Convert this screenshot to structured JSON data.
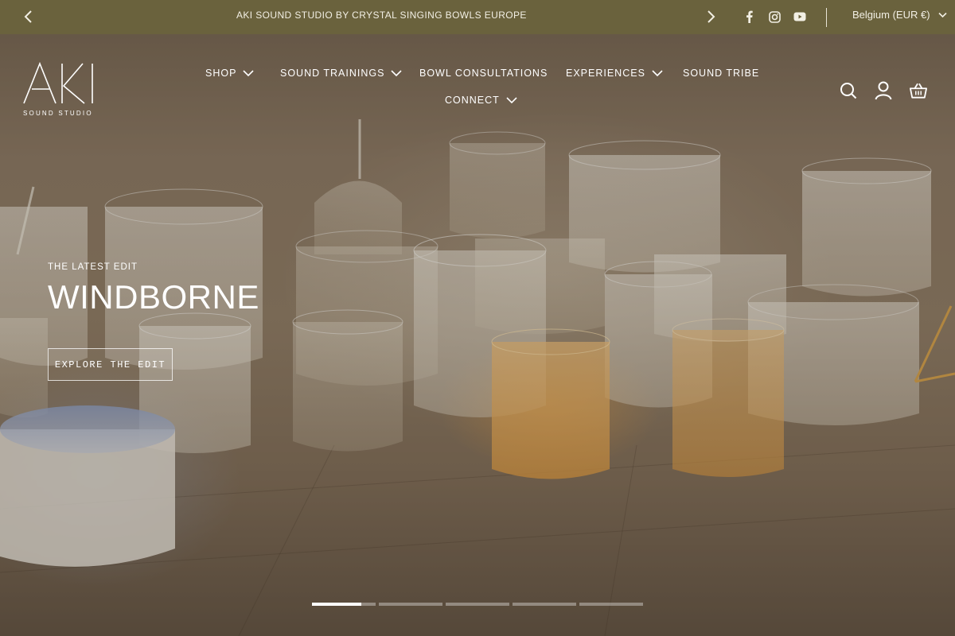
{
  "announcement": {
    "text": "AKI SOUND STUDIO BY CRYSTAL SINGING BOWLS EUROPE",
    "prev_icon": "chevron-left-icon",
    "next_icon": "chevron-right-icon"
  },
  "socials": [
    {
      "name": "facebook-icon"
    },
    {
      "name": "instagram-icon"
    },
    {
      "name": "youtube-icon"
    }
  ],
  "country_selector": {
    "label": "Belgium (EUR €)"
  },
  "brand": {
    "logo_text": "AKI",
    "sub": "SOUND STUDIO"
  },
  "nav": {
    "shop": "SHOP",
    "sound_trainings": "SOUND TRAININGS",
    "bowl_consultations": "BOWL CONSULTATIONS",
    "experiences": "EXPERIENCES",
    "sound_tribe": "SOUND TRIBE",
    "connect": "CONNECT"
  },
  "header_icons": [
    "search-icon",
    "account-icon",
    "cart-icon"
  ],
  "hero": {
    "eyebrow": "THE LATEST EDIT",
    "headline": "WINDBORNE",
    "cta": "EXPLORE THE EDIT"
  },
  "slider": {
    "count": 5,
    "active_index": 0,
    "active_progress": 0.78
  },
  "colors": {
    "announcement_bg": "#6a623d",
    "text": "#ffffff"
  }
}
